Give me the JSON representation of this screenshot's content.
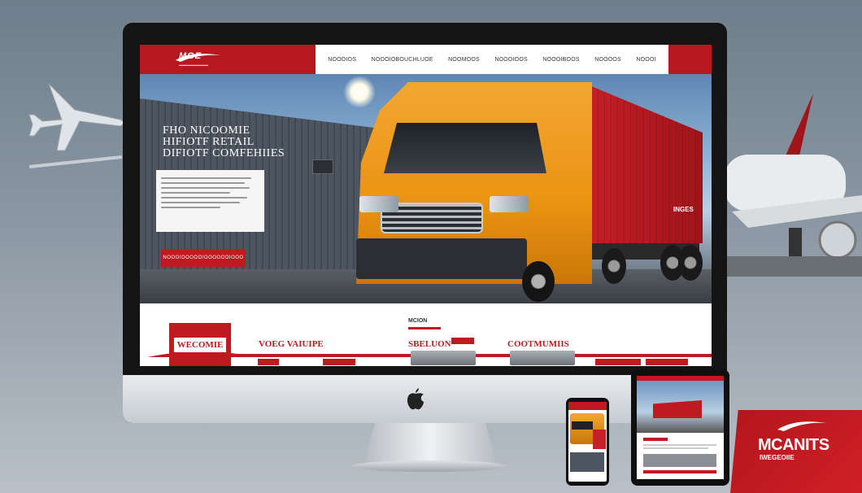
{
  "site": {
    "logo_text": "MGE"
  },
  "nav": {
    "items": [
      "NOOOIOS",
      "NOOOIOBOUCHLUOE",
      "NOOMOOS",
      "NOOOIOOS",
      "NOOOIBOOS",
      "NOOOOS",
      "NOOOI"
    ]
  },
  "hero": {
    "title_lines": [
      "FHO NICOOMIE",
      "HIFIOTF RETAIL",
      "DIFIOTF COMFEHIIES"
    ],
    "button_label": "NOOOIOOOOOIOOOOOOIOOO",
    "trailer_text": "INGES"
  },
  "sections": {
    "welcome": "WECOMIE",
    "values": "VOEG VAIUIPE",
    "center_label": "MCION",
    "solution": "SBELUON",
    "commitments": "COOTMUMIIS"
  },
  "brand": {
    "name": "MCANITS",
    "sub": "IWEGEOIIE"
  },
  "colors": {
    "brand_red": "#c0191f",
    "truck_orange": "#eb9212",
    "nav_bg": "#ffffff"
  },
  "icons": [
    "apple-icon",
    "airplane-icon",
    "logo-swoosh-icon"
  ]
}
